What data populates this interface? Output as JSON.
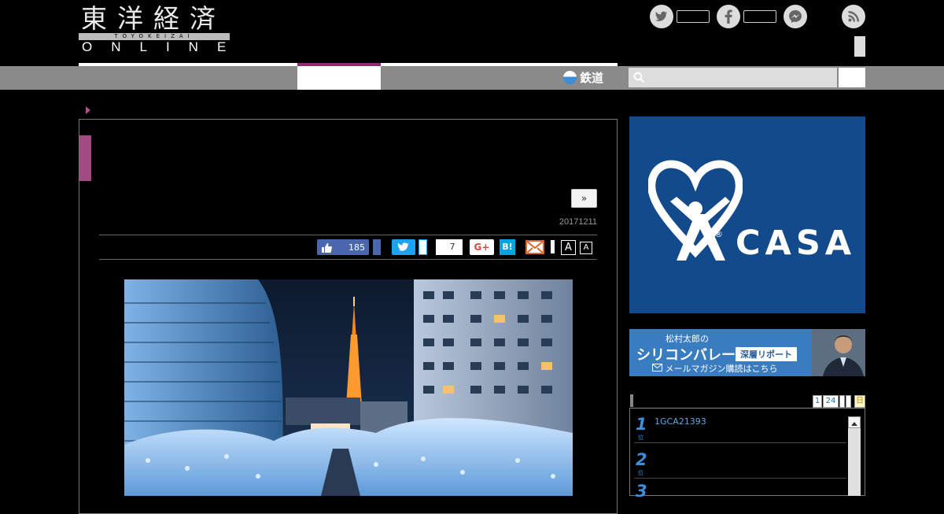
{
  "header": {
    "logo_kanji": "東洋経済",
    "logo_romaji": "TOYOKEIZAI",
    "logo_online": "ONLINE"
  },
  "nav": {
    "rail_label": "鉄道",
    "search_placeholder": ""
  },
  "article": {
    "next_label": "»",
    "date": "20171211",
    "like_count": "185",
    "hatena_count": "7",
    "gplus_label": "G+",
    "hatena_label": "B!",
    "font_large_label": "A",
    "font_small_label": "A"
  },
  "sidebar": {
    "casa_ad": {
      "brand": "CASA",
      "registered": "®"
    },
    "silicon_ad": {
      "author": "松村太郎の",
      "title": "シリコンバレー",
      "subtitle": "深層リポート",
      "cta": "メールマガジン購読はこちら"
    },
    "ranking": {
      "pages": [
        "1",
        "24",
        "",
        "",
        "日"
      ],
      "items": [
        {
          "rank": "1",
          "unit": "位",
          "text": "1GCA21393"
        },
        {
          "rank": "2",
          "unit": "位",
          "text": ""
        },
        {
          "rank": "3",
          "unit": "位",
          "text": ""
        }
      ]
    }
  },
  "colors": {
    "accent_purple": "#8b2d6f",
    "nav_gray": "#8a8a8a",
    "casa_blue": "#124a8c",
    "ranking_blue": "#3e8fd9"
  }
}
